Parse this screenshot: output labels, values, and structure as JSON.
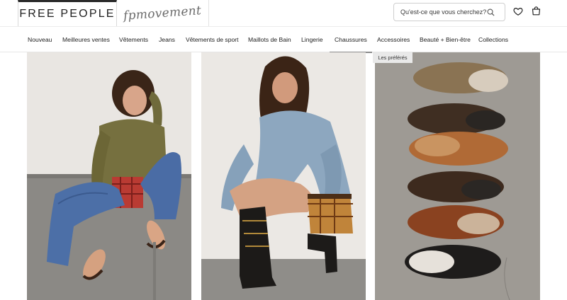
{
  "brand": {
    "logo": "FREE PEOPLE",
    "sub_logo": "fpmovement"
  },
  "search": {
    "placeholder": "Qu'est-ce que vous cherchez?"
  },
  "icons": {
    "search": "search-icon",
    "wishlist": "heart-icon",
    "bag": "shopping-bag-icon"
  },
  "nav": {
    "items": [
      "Nouveau",
      "Meilleures ventes",
      "Vêtements",
      "Jeans",
      "Vêtements de sport",
      "Maillots de Bain",
      "Lingerie",
      "Chaussures",
      "Accessoires",
      "Beauté + Bien-être",
      "Collections"
    ],
    "active": "Chaussures",
    "tooltip": "Les préférés"
  },
  "colors": {
    "text": "#1e1e1e",
    "border": "#e6e6e6",
    "tile_bg": "#e8e6e3"
  }
}
